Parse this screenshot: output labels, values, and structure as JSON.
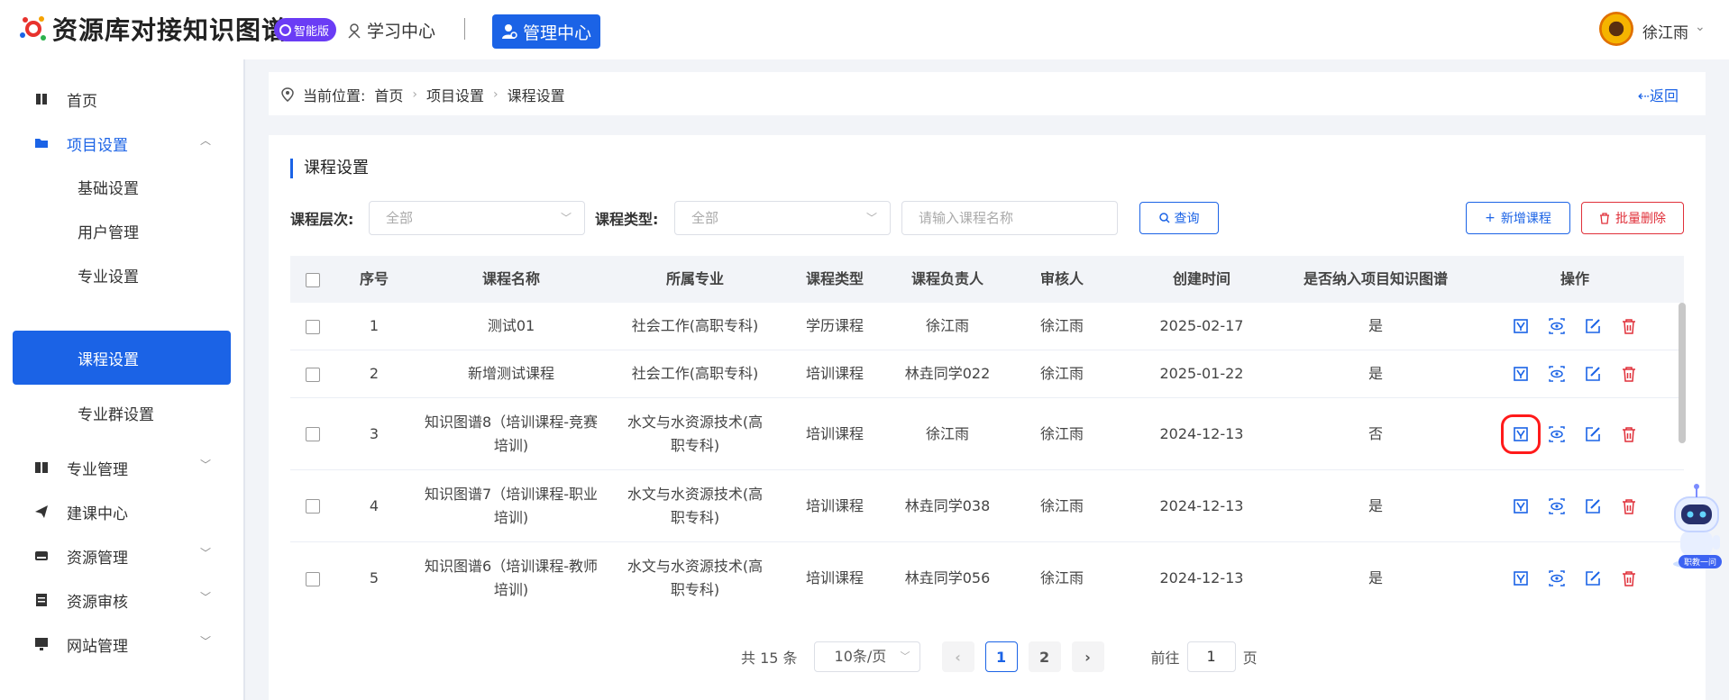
{
  "header": {
    "app_title": "资源库对接知识图谱",
    "ai_badge": "智能版",
    "nav_learn": "学习中心",
    "nav_manage": "管理中心",
    "user_name": "徐江雨"
  },
  "sidebar": {
    "items": [
      {
        "label": "首页"
      },
      {
        "label": "项目设置"
      },
      {
        "label": "基础设置"
      },
      {
        "label": "用户管理"
      },
      {
        "label": "专业设置"
      },
      {
        "label": "课程设置"
      },
      {
        "label": "专业群设置"
      },
      {
        "label": "专业管理"
      },
      {
        "label": "建课中心"
      },
      {
        "label": "资源管理"
      },
      {
        "label": "资源审核"
      },
      {
        "label": "网站管理"
      }
    ]
  },
  "breadcrumb": {
    "prefix": "当前位置:",
    "items": [
      "首页",
      "项目设置",
      "课程设置"
    ],
    "back": "返回"
  },
  "main": {
    "title": "课程设置",
    "filters": {
      "level_label": "课程层次:",
      "level_value": "全部",
      "type_label": "课程类型:",
      "type_value": "全部",
      "name_placeholder": "请输入课程名称",
      "query": "查询",
      "add": "新增课程",
      "batch_delete": "批量删除"
    },
    "table": {
      "headers": [
        "序号",
        "课程名称",
        "所属专业",
        "课程类型",
        "课程负责人",
        "审核人",
        "创建时间",
        "是否纳入项目知识图谱",
        "操作"
      ],
      "rows": [
        {
          "no": "1",
          "name": "测试01",
          "major": "社会工作(高职专科)",
          "type": "学历课程",
          "owner": "徐江雨",
          "reviewer": "徐江雨",
          "created": "2025-02-17",
          "in_graph": "是"
        },
        {
          "no": "2",
          "name": "新增测试课程",
          "major": "社会工作(高职专科)",
          "type": "培训课程",
          "owner": "林垚同学022",
          "reviewer": "徐江雨",
          "created": "2025-01-22",
          "in_graph": "是"
        },
        {
          "no": "3",
          "name": "知识图谱8（培训课程-竞赛培训)",
          "major": "水文与水资源技术(高职专科)",
          "type": "培训课程",
          "owner": "徐江雨",
          "reviewer": "徐江雨",
          "created": "2024-12-13",
          "in_graph": "否"
        },
        {
          "no": "4",
          "name": "知识图谱7（培训课程-职业培训)",
          "major": "水文与水资源技术(高职专科)",
          "type": "培训课程",
          "owner": "林垚同学038",
          "reviewer": "徐江雨",
          "created": "2024-12-13",
          "in_graph": "是"
        },
        {
          "no": "5",
          "name": "知识图谱6（培训课程-教师培训)",
          "major": "水文与水资源技术(高职专科)",
          "type": "培训课程",
          "owner": "林垚同学056",
          "reviewer": "徐江雨",
          "created": "2024-12-13",
          "in_graph": "是"
        }
      ]
    },
    "pagination": {
      "total": "共 15 条",
      "page_size": "10条/页",
      "pages": [
        "1",
        "2"
      ],
      "goto_prefix": "前往",
      "goto_value": "1",
      "goto_suffix": "页"
    }
  },
  "assistant": {
    "label": "职教一问"
  },
  "colors": {
    "primary": "#1b63e6",
    "danger": "#e0303a",
    "badge": "#6a3cf5",
    "highlight": "#ff1a1a"
  }
}
